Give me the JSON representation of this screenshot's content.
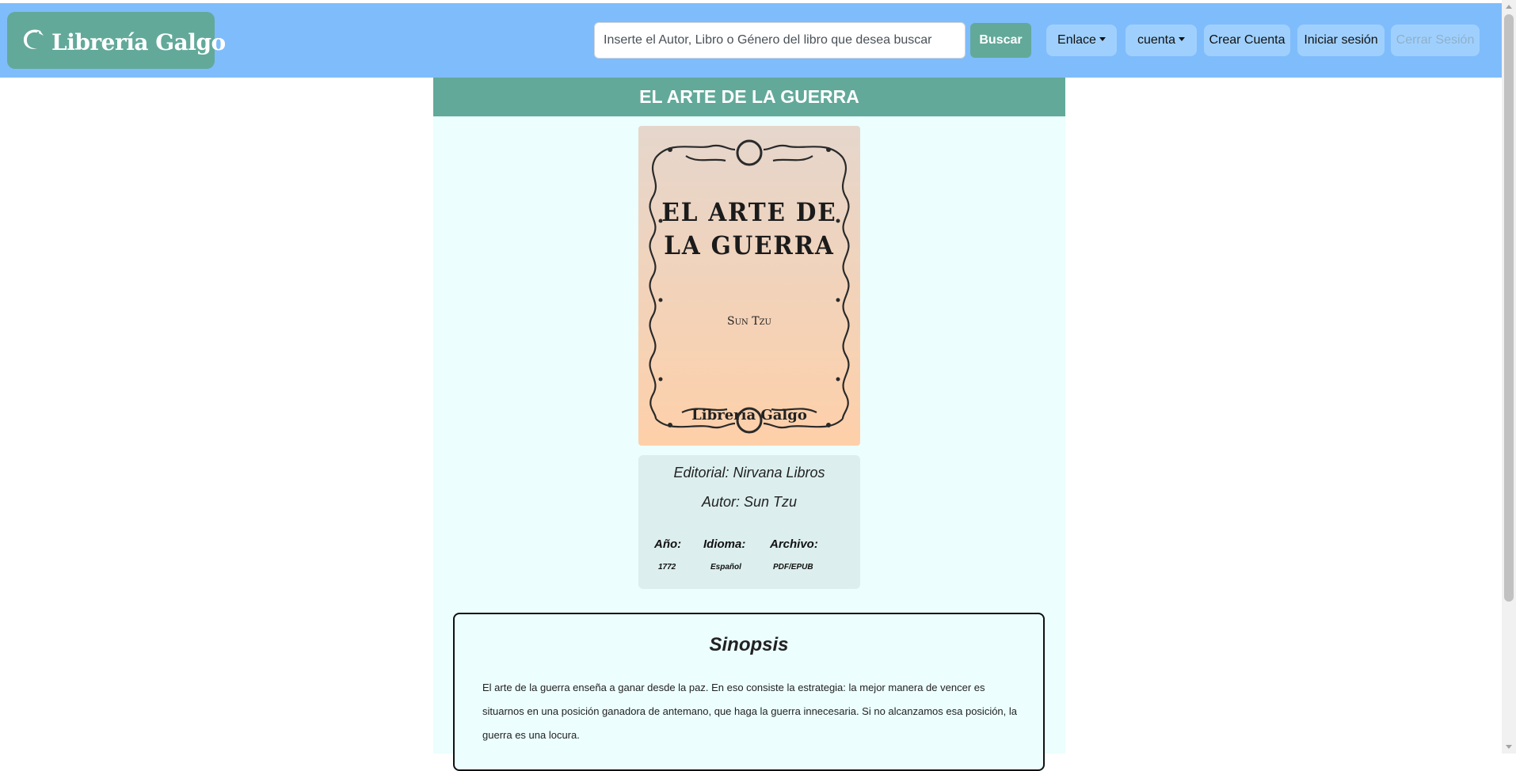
{
  "brand": {
    "name": "Librería Galgo",
    "icon": "galgo-dog-icon"
  },
  "search": {
    "placeholder": "Inserte el Autor, Libro o Género del libro que desea buscar",
    "button": "Buscar"
  },
  "nav": {
    "enlace": "Enlace",
    "cuenta": "cuenta",
    "crear_cuenta": "Crear Cuenta",
    "iniciar_sesion": "Iniciar sesión",
    "cerrar_sesion": "Cerrar Sesión"
  },
  "book": {
    "title": "EL ARTE DE LA GUERRA",
    "cover": {
      "title_line1": "EL ARTE DE",
      "title_line2": "LA GUERRA",
      "author": "Sun Tzu",
      "publisher": "Librería Galgo"
    },
    "editorial_label": "Editorial:",
    "editorial": "Nirvana Libros",
    "autor_label": "Autor:",
    "autor": "Sun Tzu",
    "anio_label": "Año:",
    "anio": "1772",
    "idioma_label": "Idioma:",
    "idioma": "Español",
    "archivo_label": "Archivo:",
    "archivo": "PDF/EPUB"
  },
  "synopsis": {
    "title": "Sinopsis",
    "text": "El arte de la guerra enseña a ganar desde la paz. En eso consiste la estrategia: la mejor manera de vencer es situarnos en una posición ganadora de antemano, que haga la guerra innecesaria. Si no alcanzamos esa posición, la guerra es una locura."
  },
  "colors": {
    "navbar": "#7fbcfc",
    "accent": "#62a99a",
    "content_bg": "#ecfefe"
  }
}
